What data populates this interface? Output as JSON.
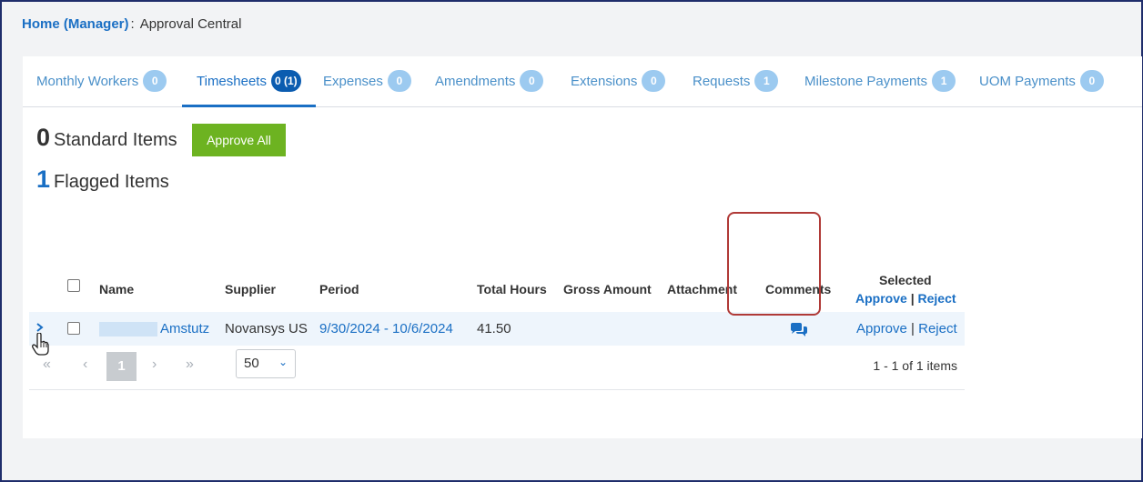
{
  "breadcrumb": {
    "home": "Home (Manager)",
    "separator": ":",
    "current": "Approval Central"
  },
  "tabs": [
    {
      "label": "Monthly Workers",
      "badge": "0"
    },
    {
      "label": "Timesheets",
      "badge": "0 (1)"
    },
    {
      "label": "Expenses",
      "badge": "0"
    },
    {
      "label": "Amendments",
      "badge": "0"
    },
    {
      "label": "Extensions",
      "badge": "0"
    },
    {
      "label": "Requests",
      "badge": "1"
    },
    {
      "label": "Milestone Payments",
      "badge": "1"
    },
    {
      "label": "UOM Payments",
      "badge": "0"
    }
  ],
  "summary": {
    "standard_count": "0",
    "standard_label": "Standard Items",
    "approve_all": "Approve All",
    "flagged_count": "1",
    "flagged_label": "Flagged Items"
  },
  "grid": {
    "headers": {
      "name": "Name",
      "supplier": "Supplier",
      "period": "Period",
      "total_hours": "Total Hours",
      "gross_amount": "Gross Amount",
      "attachment": "Attachment",
      "comments": "Comments",
      "selected": "Selected",
      "approve": "Approve",
      "reject": "Reject",
      "divider": "|"
    },
    "row": {
      "name": "Amstutz",
      "supplier": "Novansys US",
      "period": "9/30/2024 - 10/6/2024",
      "total_hours": "41.50",
      "approve": "Approve",
      "reject": "Reject"
    }
  },
  "pager": {
    "first": "«",
    "prev": "‹",
    "current": "1",
    "next": "›",
    "last": "»",
    "page_size": "50",
    "info": "1 - 1 of 1 items"
  },
  "icons": {
    "expand": "chevron-right-icon",
    "comments": "comments-icon",
    "cursor": "hand-pointer-icon"
  },
  "colors": {
    "link": "#1a6fc4",
    "approve_all": "#6db321",
    "highlight": "#b03a37",
    "badge": "#9ccaf0"
  }
}
